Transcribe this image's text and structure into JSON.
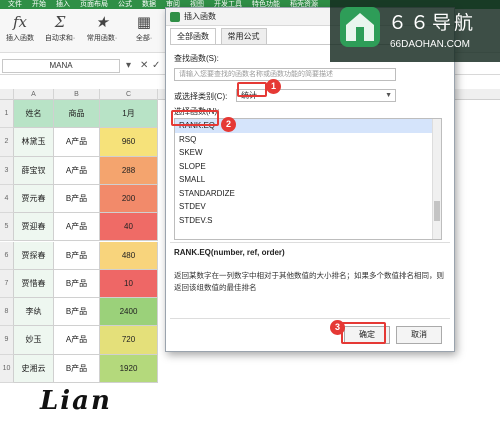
{
  "topbar": {
    "items": [
      "文件",
      "开始",
      "插入",
      "页面布局",
      "公式",
      "数据",
      "审阅",
      "视图",
      "开发工具",
      "特色功能",
      "稻壳资源"
    ]
  },
  "ribbon": {
    "buttons": [
      {
        "icon": "fx",
        "label": "插入函数"
      },
      {
        "icon": "Σ",
        "label": "自动求和·"
      },
      {
        "icon": "★",
        "label": "常用函数·"
      },
      {
        "icon": "▦",
        "label": "全部·"
      }
    ]
  },
  "formula_bar": {
    "name_box": "MANA",
    "cancel": "✕",
    "confirm": "✓",
    "fx": "fx"
  },
  "sheet": {
    "col_headers": [
      "A",
      "B",
      "C"
    ],
    "row_numbers": [
      "1",
      "2",
      "3",
      "4",
      "5",
      "6",
      "7",
      "8",
      "9",
      "10",
      "11"
    ],
    "header_row": [
      "姓名",
      "商品",
      "1月"
    ],
    "rows": [
      {
        "name": "林黛玉",
        "product": "A产品",
        "value": "960",
        "color": "#f6e27a"
      },
      {
        "name": "薛宝钗",
        "product": "A产品",
        "value": "288",
        "color": "#f4a46e"
      },
      {
        "name": "贾元春",
        "product": "B产品",
        "value": "200",
        "color": "#f28a6a"
      },
      {
        "name": "贾迎春",
        "product": "A产品",
        "value": "40",
        "color": "#ef6b66"
      },
      {
        "name": "贾探春",
        "product": "B产品",
        "value": "480",
        "color": "#f8d47c"
      },
      {
        "name": "贾惜春",
        "product": "B产品",
        "value": "10",
        "color": "#ee6766"
      },
      {
        "name": "李纨",
        "product": "B产品",
        "value": "2400",
        "color": "#9bd17a"
      },
      {
        "name": "妙玉",
        "product": "A产品",
        "value": "720",
        "color": "#e4e07a"
      },
      {
        "name": "史湘云",
        "product": "B产品",
        "value": "1920",
        "color": "#b4d97c"
      }
    ]
  },
  "dialog": {
    "title": "插入函数",
    "tabs": [
      "全部函数",
      "常用公式"
    ],
    "search_label": "查找函数(S):",
    "search_placeholder": "请输入您要查找的函数名称或函数功能的简要描述",
    "category_label": "或选择类别(C):",
    "category_value": "统计",
    "list_label": "选择函数(N):",
    "functions": [
      "RANK.EQ",
      "RSQ",
      "SKEW",
      "SLOPE",
      "SMALL",
      "STANDARDIZE",
      "STDEV",
      "STDEV.S"
    ],
    "selected": "RANK.EQ",
    "signature": "RANK.EQ(number, ref, order)",
    "description": "返回某数字在一列数字中相对于其他数值的大小排名；如果多个数值排名相同，则返回该组数值的最佳排名",
    "ok_label": "确定",
    "cancel_label": "取消"
  },
  "markers": [
    "1",
    "2",
    "3"
  ],
  "logo": {
    "title": "６６导航",
    "subtitle": "66DAOHAN.COM"
  },
  "watermark": {
    "text": "Lian"
  },
  "colors": {
    "accent": "#2f8f46",
    "marker": "#e53935",
    "selection": "#d5e4fb"
  }
}
